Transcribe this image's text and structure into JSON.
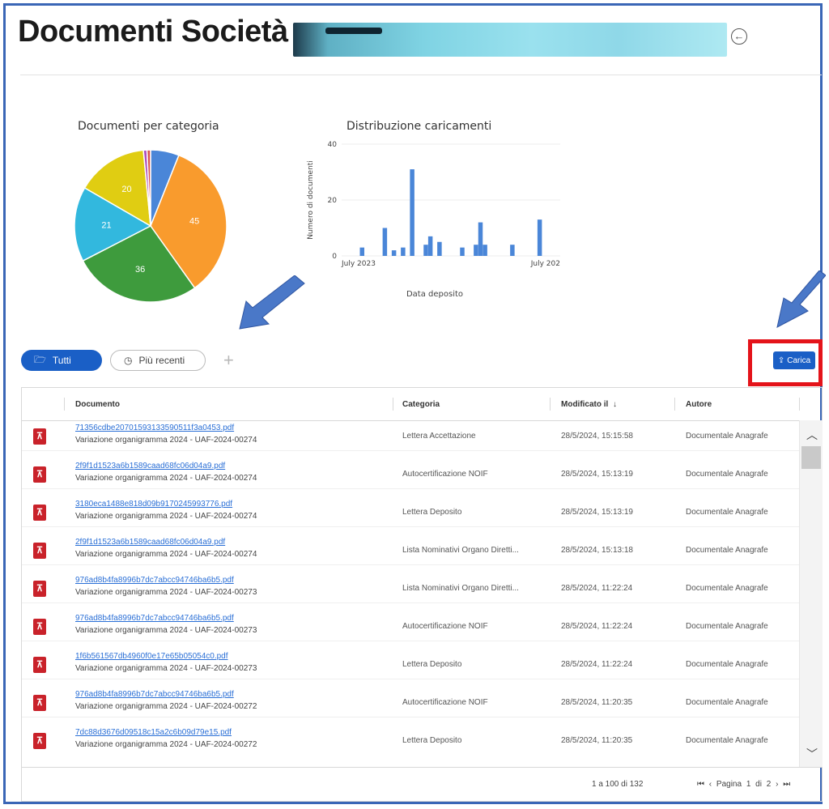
{
  "header": {
    "title": "Documenti Società -"
  },
  "charts": {
    "pie_title": "Documenti per categoria",
    "bar_title": "Distribuzione caricamenti"
  },
  "chart_data": [
    {
      "type": "pie",
      "title": "Documenti per categoria",
      "values": [
        45,
        36,
        21,
        20,
        8,
        1,
        1
      ],
      "labels": [
        "45",
        "36",
        "21",
        "20",
        "",
        "",
        ""
      ],
      "colors": [
        "#f99b2d",
        "#3e9b3d",
        "#32b8de",
        "#e0cd12",
        "#4a86d8",
        "#ad4fc0",
        "#d9534f"
      ]
    },
    {
      "type": "bar",
      "title": "Distribuzione caricamenti",
      "xlabel": "Data deposito",
      "ylabel": "Numero di documenti",
      "y_ticks": [
        "0",
        "20",
        "40"
      ],
      "x_ticks": [
        "July 2023",
        "July 202"
      ],
      "ylim": [
        0,
        40
      ],
      "values": [
        3,
        10,
        2,
        3,
        31,
        4,
        7,
        5,
        3,
        4,
        12,
        4,
        4,
        13
      ],
      "bar_color": "#4a86d8"
    }
  ],
  "tabs": [
    {
      "label": "Tutti",
      "icon": "folder-open-icon"
    },
    {
      "label": "Più recenti",
      "icon": "clock-icon"
    }
  ],
  "upload_label": "Carica",
  "table": {
    "headers": {
      "document": "Documento",
      "category": "Categoria",
      "modified": "Modificato il",
      "author": "Autore"
    },
    "rows": [
      {
        "file": "71356cdbe20701593133590511f3a0453.pdf",
        "desc": "Variazione organigramma 2024 - UAF-2024-00274",
        "category": "Lettera Accettazione",
        "modified": "28/5/2024, 15:15:58",
        "author": "Documentale Anagrafe"
      },
      {
        "file": "2f9f1d1523a6b1589caad68fc06d04a9.pdf",
        "desc": "Variazione organigramma 2024 - UAF-2024-00274",
        "category": "Autocertificazione NOIF",
        "modified": "28/5/2024, 15:13:19",
        "author": "Documentale Anagrafe"
      },
      {
        "file": "3180eca1488e818d09b9170245993776.pdf",
        "desc": "Variazione organigramma 2024 - UAF-2024-00274",
        "category": "Lettera Deposito",
        "modified": "28/5/2024, 15:13:19",
        "author": "Documentale Anagrafe"
      },
      {
        "file": "2f9f1d1523a6b1589caad68fc06d04a9.pdf",
        "desc": "Variazione organigramma 2024 - UAF-2024-00274",
        "category": "Lista Nominativi Organo Diretti...",
        "modified": "28/5/2024, 15:13:18",
        "author": "Documentale Anagrafe"
      },
      {
        "file": "976ad8b4fa8996b7dc7abcc94746ba6b5.pdf",
        "desc": "Variazione organigramma 2024 - UAF-2024-00273",
        "category": "Lista Nominativi Organo Diretti...",
        "modified": "28/5/2024, 11:22:24",
        "author": "Documentale Anagrafe"
      },
      {
        "file": "976ad8b4fa8996b7dc7abcc94746ba6b5.pdf",
        "desc": "Variazione organigramma 2024 - UAF-2024-00273",
        "category": "Autocertificazione NOIF",
        "modified": "28/5/2024, 11:22:24",
        "author": "Documentale Anagrafe"
      },
      {
        "file": "1f6b561567db4960f0e17e65b05054c0.pdf",
        "desc": "Variazione organigramma 2024 - UAF-2024-00273",
        "category": "Lettera Deposito",
        "modified": "28/5/2024, 11:22:24",
        "author": "Documentale Anagrafe"
      },
      {
        "file": "976ad8b4fa8996b7dc7abcc94746ba6b5.pdf",
        "desc": "Variazione organigramma 2024 - UAF-2024-00272",
        "category": "Autocertificazione NOIF",
        "modified": "28/5/2024, 11:20:35",
        "author": "Documentale Anagrafe"
      },
      {
        "file": "7dc88d3676d09518c15a2c6b09d79e15.pdf",
        "desc": "Variazione organigramma 2024 - UAF-2024-00272",
        "category": "Lettera Deposito",
        "modified": "28/5/2024, 11:20:35",
        "author": "Documentale Anagrafe"
      }
    ],
    "footer": {
      "count": "1 a 100 di 132",
      "pager": "Pagina 1 di 2"
    }
  }
}
